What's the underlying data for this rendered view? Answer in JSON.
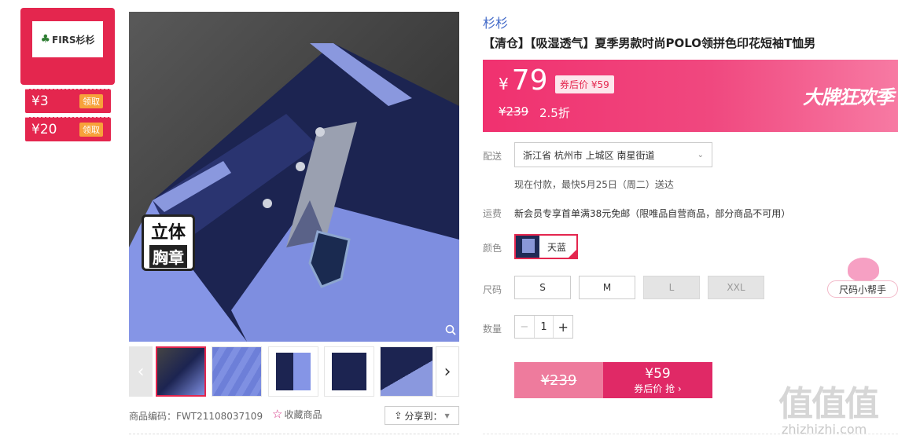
{
  "coupons": {
    "store_logo": "FIRS杉杉",
    "items": [
      {
        "amount": "¥3",
        "action": "领取"
      },
      {
        "amount": "¥20",
        "action": "领取"
      }
    ]
  },
  "gallery": {
    "badge_line1": "立体",
    "badge_line2": "胸章",
    "prev_label": "‹",
    "next_label": "›",
    "product_code": "商品编码：FWT21108037109",
    "favorite": "收藏商品",
    "share": "分享到："
  },
  "product": {
    "brand": "杉杉",
    "title": "【清仓】【吸湿透气】夏季男款时尚POLO领拼色印花短袖T恤男"
  },
  "price": {
    "currency": "¥",
    "current": "79",
    "after_coupon": "券后价 ¥59",
    "original": "¥239",
    "discount": "2.5折",
    "banner": "大牌狂欢季"
  },
  "delivery": {
    "label": "配送",
    "address": "浙江省 杭州市 上城区 南星街道",
    "note": "现在付款，最快5月25日（周二）送达"
  },
  "freight": {
    "label": "运费",
    "text": "新会员专享首单满38元免邮（限唯品自营商品，部分商品不可用）"
  },
  "color": {
    "label": "颜色",
    "selected": "天蓝"
  },
  "size": {
    "label": "尺码",
    "options": [
      {
        "label": "S",
        "available": true
      },
      {
        "label": "M",
        "available": true
      },
      {
        "label": "L",
        "available": false
      },
      {
        "label": "XXL",
        "available": false
      }
    ]
  },
  "quantity": {
    "label": "数量",
    "value": "1",
    "minus": "−",
    "plus": "+"
  },
  "buy": {
    "original": "¥239",
    "price": "¥59",
    "action": "券后价 抢 ›"
  },
  "helper": "尺码小帮手",
  "watermark": {
    "logo": "值值值",
    "site": "zhizhizhi.com"
  }
}
